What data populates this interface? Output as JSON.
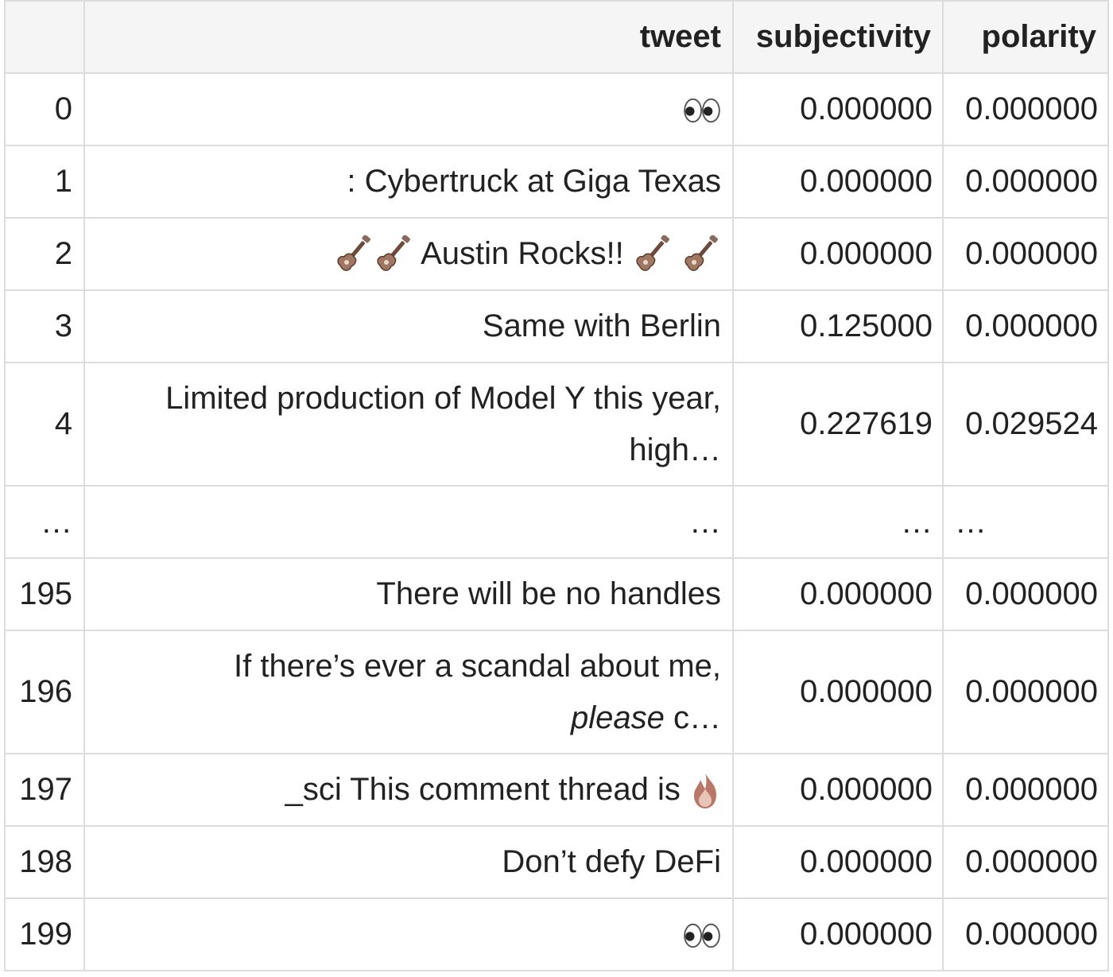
{
  "table": {
    "columns": {
      "index": "",
      "tweet": "tweet",
      "subjectivity": "subjectivity",
      "polarity": "polarity"
    },
    "rows": [
      {
        "index": "0",
        "tweet_text": "",
        "tweet_icons": [
          "eyes-icon"
        ],
        "subjectivity": "0.000000",
        "polarity": "0.000000"
      },
      {
        "index": "1",
        "tweet_text": ": Cybertruck at Giga Texas",
        "subjectivity": "0.000000",
        "polarity": "0.000000"
      },
      {
        "index": "2",
        "tweet_before": "",
        "tweet_text": "Austin Rocks!!",
        "tweet_icons": [
          "guitar-icon",
          "guitar-icon",
          "guitar-icon",
          "guitar-icon"
        ],
        "subjectivity": "0.000000",
        "polarity": "0.000000"
      },
      {
        "index": "3",
        "tweet_text": "Same with Berlin",
        "subjectivity": "0.125000",
        "polarity": "0.000000"
      },
      {
        "index": "4",
        "tweet_line1": "Limited production of Model Y this year,",
        "tweet_line2": "high…",
        "subjectivity": "0.227619",
        "polarity": "0.029524"
      },
      {
        "index": "…",
        "tweet_text": "…",
        "subjectivity": "…",
        "polarity": "…"
      },
      {
        "index": "195",
        "tweet_text": "There will be no handles",
        "subjectivity": "0.000000",
        "polarity": "0.000000"
      },
      {
        "index": "196",
        "tweet_line1": "If there’s ever a scandal about me,",
        "tweet_line2_italic": "please",
        "tweet_line2_rest": " c…",
        "subjectivity": "0.000000",
        "polarity": "0.000000"
      },
      {
        "index": "197",
        "tweet_text": "_sci This comment thread is",
        "tweet_icons": [
          "fire-icon"
        ],
        "subjectivity": "0.000000",
        "polarity": "0.000000"
      },
      {
        "index": "198",
        "tweet_text": "Don’t defy DeFi",
        "subjectivity": "0.000000",
        "polarity": "0.000000"
      },
      {
        "index": "199",
        "tweet_text": "",
        "tweet_icons": [
          "eyes-icon"
        ],
        "subjectivity": "0.000000",
        "polarity": "0.000000"
      }
    ]
  }
}
